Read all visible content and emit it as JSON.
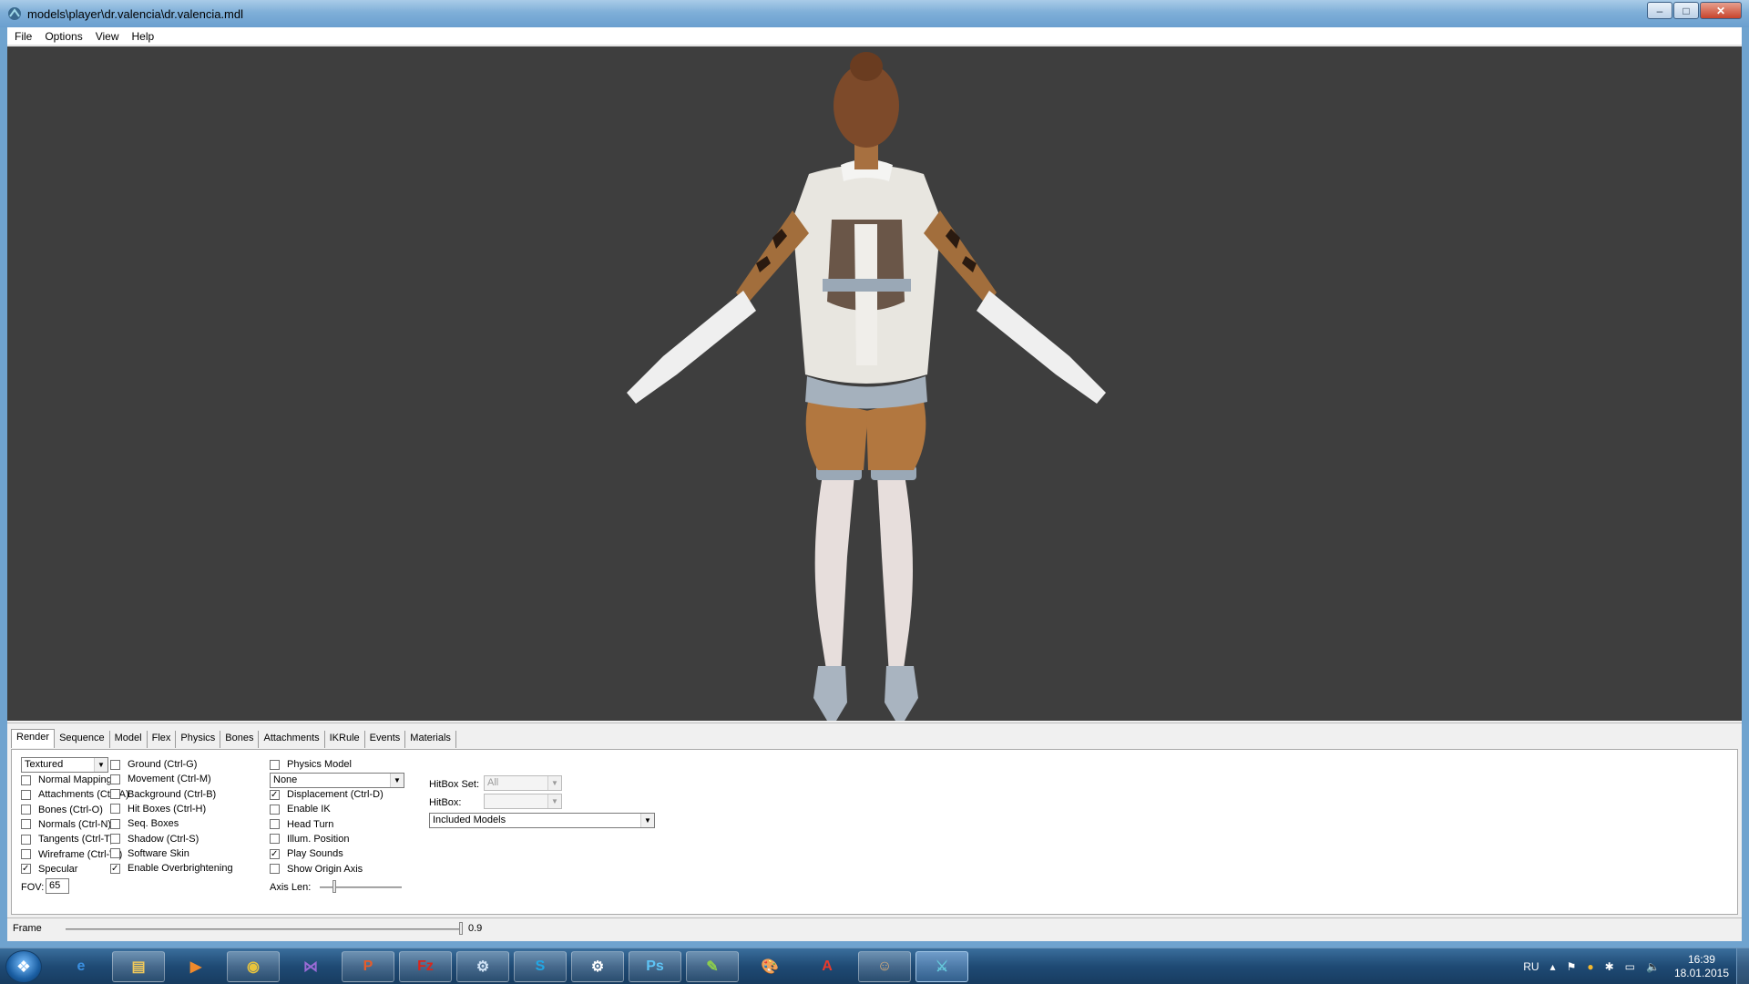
{
  "window": {
    "title": "models\\player\\dr.valencia\\dr.valencia.mdl",
    "minimize": "–",
    "maximize": "□",
    "close": "✕"
  },
  "menu": [
    "File",
    "Options",
    "View",
    "Help"
  ],
  "tabs": [
    "Render",
    "Sequence",
    "Model",
    "Flex",
    "Physics",
    "Bones",
    "Attachments",
    "IKRule",
    "Events",
    "Materials"
  ],
  "active_tab": "Render",
  "render": {
    "mode_select": "Textured",
    "col1": [
      {
        "label": "Normal Mapping",
        "checked": false
      },
      {
        "label": "Attachments (Ctrl-A)",
        "checked": false
      },
      {
        "label": "Bones (Ctrl-O)",
        "checked": false
      },
      {
        "label": "Normals (Ctrl-N)",
        "checked": false
      },
      {
        "label": "Tangents (Ctrl-T)",
        "checked": false
      },
      {
        "label": "Wireframe (Ctrl-W)",
        "checked": false
      },
      {
        "label": "Specular",
        "checked": true
      }
    ],
    "fov_label": "FOV:",
    "fov_value": "65",
    "col2": [
      {
        "label": "Ground (Ctrl-G)",
        "checked": false
      },
      {
        "label": "Movement (Ctrl-M)",
        "checked": false
      },
      {
        "label": "Background (Ctrl-B)",
        "checked": false
      },
      {
        "label": "Hit Boxes (Ctrl-H)",
        "checked": false
      },
      {
        "label": "Seq. Boxes",
        "checked": false
      },
      {
        "label": "Shadow (Ctrl-S)",
        "checked": false
      },
      {
        "label": "Software Skin",
        "checked": false
      },
      {
        "label": "Enable Overbrightening",
        "checked": true
      }
    ],
    "col3_first": {
      "label": "Physics Model",
      "checked": false
    },
    "col3_select": "None",
    "col3": [
      {
        "label": "Displacement (Ctrl-D)",
        "checked": true
      },
      {
        "label": "Enable IK",
        "checked": false
      },
      {
        "label": "Head Turn",
        "checked": false
      },
      {
        "label": "Illum. Position",
        "checked": false
      },
      {
        "label": "Play Sounds",
        "checked": true
      },
      {
        "label": "Show Origin Axis",
        "checked": false
      }
    ],
    "axis_len_label": "Axis Len:",
    "axis_len_level": 0.15,
    "hitbox_set_label": "HitBox Set:",
    "hitbox_set_value": "All",
    "hitbox_label": "HitBox:",
    "hitbox_value": "",
    "models_select": "Included Models"
  },
  "frame": {
    "label": "Frame",
    "value": "0.9",
    "level": 0.99
  },
  "taskbar": {
    "apps": [
      {
        "name": "internet-explorer",
        "glyph": "e",
        "color": "#3a8fe0",
        "state": "pinned"
      },
      {
        "name": "explorer",
        "glyph": "▤",
        "color": "#f1c95b",
        "state": "running"
      },
      {
        "name": "media-player",
        "glyph": "▶",
        "color": "#f08a2c",
        "state": "pinned"
      },
      {
        "name": "chrome",
        "glyph": "◉",
        "color": "#e9c43c",
        "state": "running"
      },
      {
        "name": "visual-studio",
        "glyph": "⋈",
        "color": "#9a6bd6",
        "state": "pinned"
      },
      {
        "name": "powerpoint",
        "glyph": "P",
        "color": "#e65c2a",
        "state": "running"
      },
      {
        "name": "filezilla",
        "glyph": "Fz",
        "color": "#d9261c",
        "state": "running"
      },
      {
        "name": "steam",
        "glyph": "⚙",
        "color": "#cfe2f5",
        "state": "running"
      },
      {
        "name": "skype",
        "glyph": "S",
        "color": "#22a7e5",
        "state": "running"
      },
      {
        "name": "steam-client",
        "glyph": "⚙",
        "color": "#ffffff",
        "state": "running"
      },
      {
        "name": "photoshop",
        "glyph": "Ps",
        "color": "#5ec3f5",
        "state": "running"
      },
      {
        "name": "notepad-plus",
        "glyph": "✎",
        "color": "#8dce4c",
        "state": "running"
      },
      {
        "name": "paint",
        "glyph": "🎨",
        "color": "#e6c86e",
        "state": "pinned"
      },
      {
        "name": "acrobat",
        "glyph": "A",
        "color": "#e83a2c",
        "state": "pinned"
      },
      {
        "name": "source-sdk",
        "glyph": "☺",
        "color": "#e0b07a",
        "state": "running"
      },
      {
        "name": "hlmv",
        "glyph": "⚔",
        "color": "#64c6d9",
        "state": "active"
      }
    ],
    "lang": "RU",
    "time": "16:39",
    "date": "18.01.2015"
  }
}
